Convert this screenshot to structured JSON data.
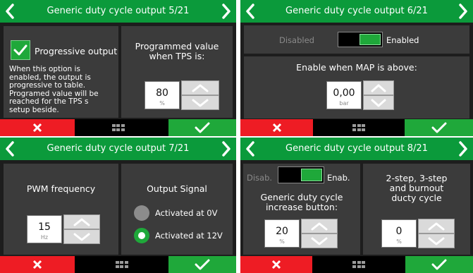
{
  "screens": [
    {
      "title": "Generic duty cycle output 5/21",
      "checkbox_label": "Progressive output",
      "description_lines": [
        "When this option is",
        "enabled, the output is",
        "progressive to table.",
        "Programed value will be",
        "reached for the TPS s",
        "setup beside."
      ],
      "right_label_lines": [
        "Programmed value",
        "when TPS is:"
      ],
      "value": "80",
      "unit": "%"
    },
    {
      "title": "Generic duty cycle output 6/21",
      "toggle_off_label": "Disabled",
      "toggle_on_label": "Enabled",
      "field_label": "Enable when MAP is above:",
      "value": "0,00",
      "unit": "bar"
    },
    {
      "title": "Generic duty cycle output 7/21",
      "left_label": "PWM frequency",
      "value": "15",
      "unit": "Hz",
      "right_label": "Output Signal",
      "options": [
        "Activated at 0V",
        "Activated at 12V"
      ],
      "selected_option": "Activated at 12V"
    },
    {
      "title": "Generic duty cycle output 8/21",
      "toggle_off_label": "Disab.",
      "toggle_on_label": "Enab.",
      "left_label_lines": [
        "Generic duty cycle",
        "increase button:"
      ],
      "left_value": "20",
      "left_unit": "%",
      "right_label_lines": [
        "2-step, 3-step",
        "and burnout",
        "ducty cycle"
      ],
      "right_value": "0",
      "right_unit": "%"
    }
  ],
  "colors": {
    "header": "#0b9a3b",
    "cancel": "#ee1c24",
    "confirm": "#1fa83a",
    "panel": "#3b3b3b",
    "background": "#1d1d1d"
  },
  "icons": {
    "prev": "chevron-left-icon",
    "next": "chevron-right-icon",
    "cancel": "close-icon",
    "menu": "grid-menu-icon",
    "confirm": "checkmark-icon",
    "up": "chevron-up-icon",
    "down": "chevron-down-icon"
  }
}
